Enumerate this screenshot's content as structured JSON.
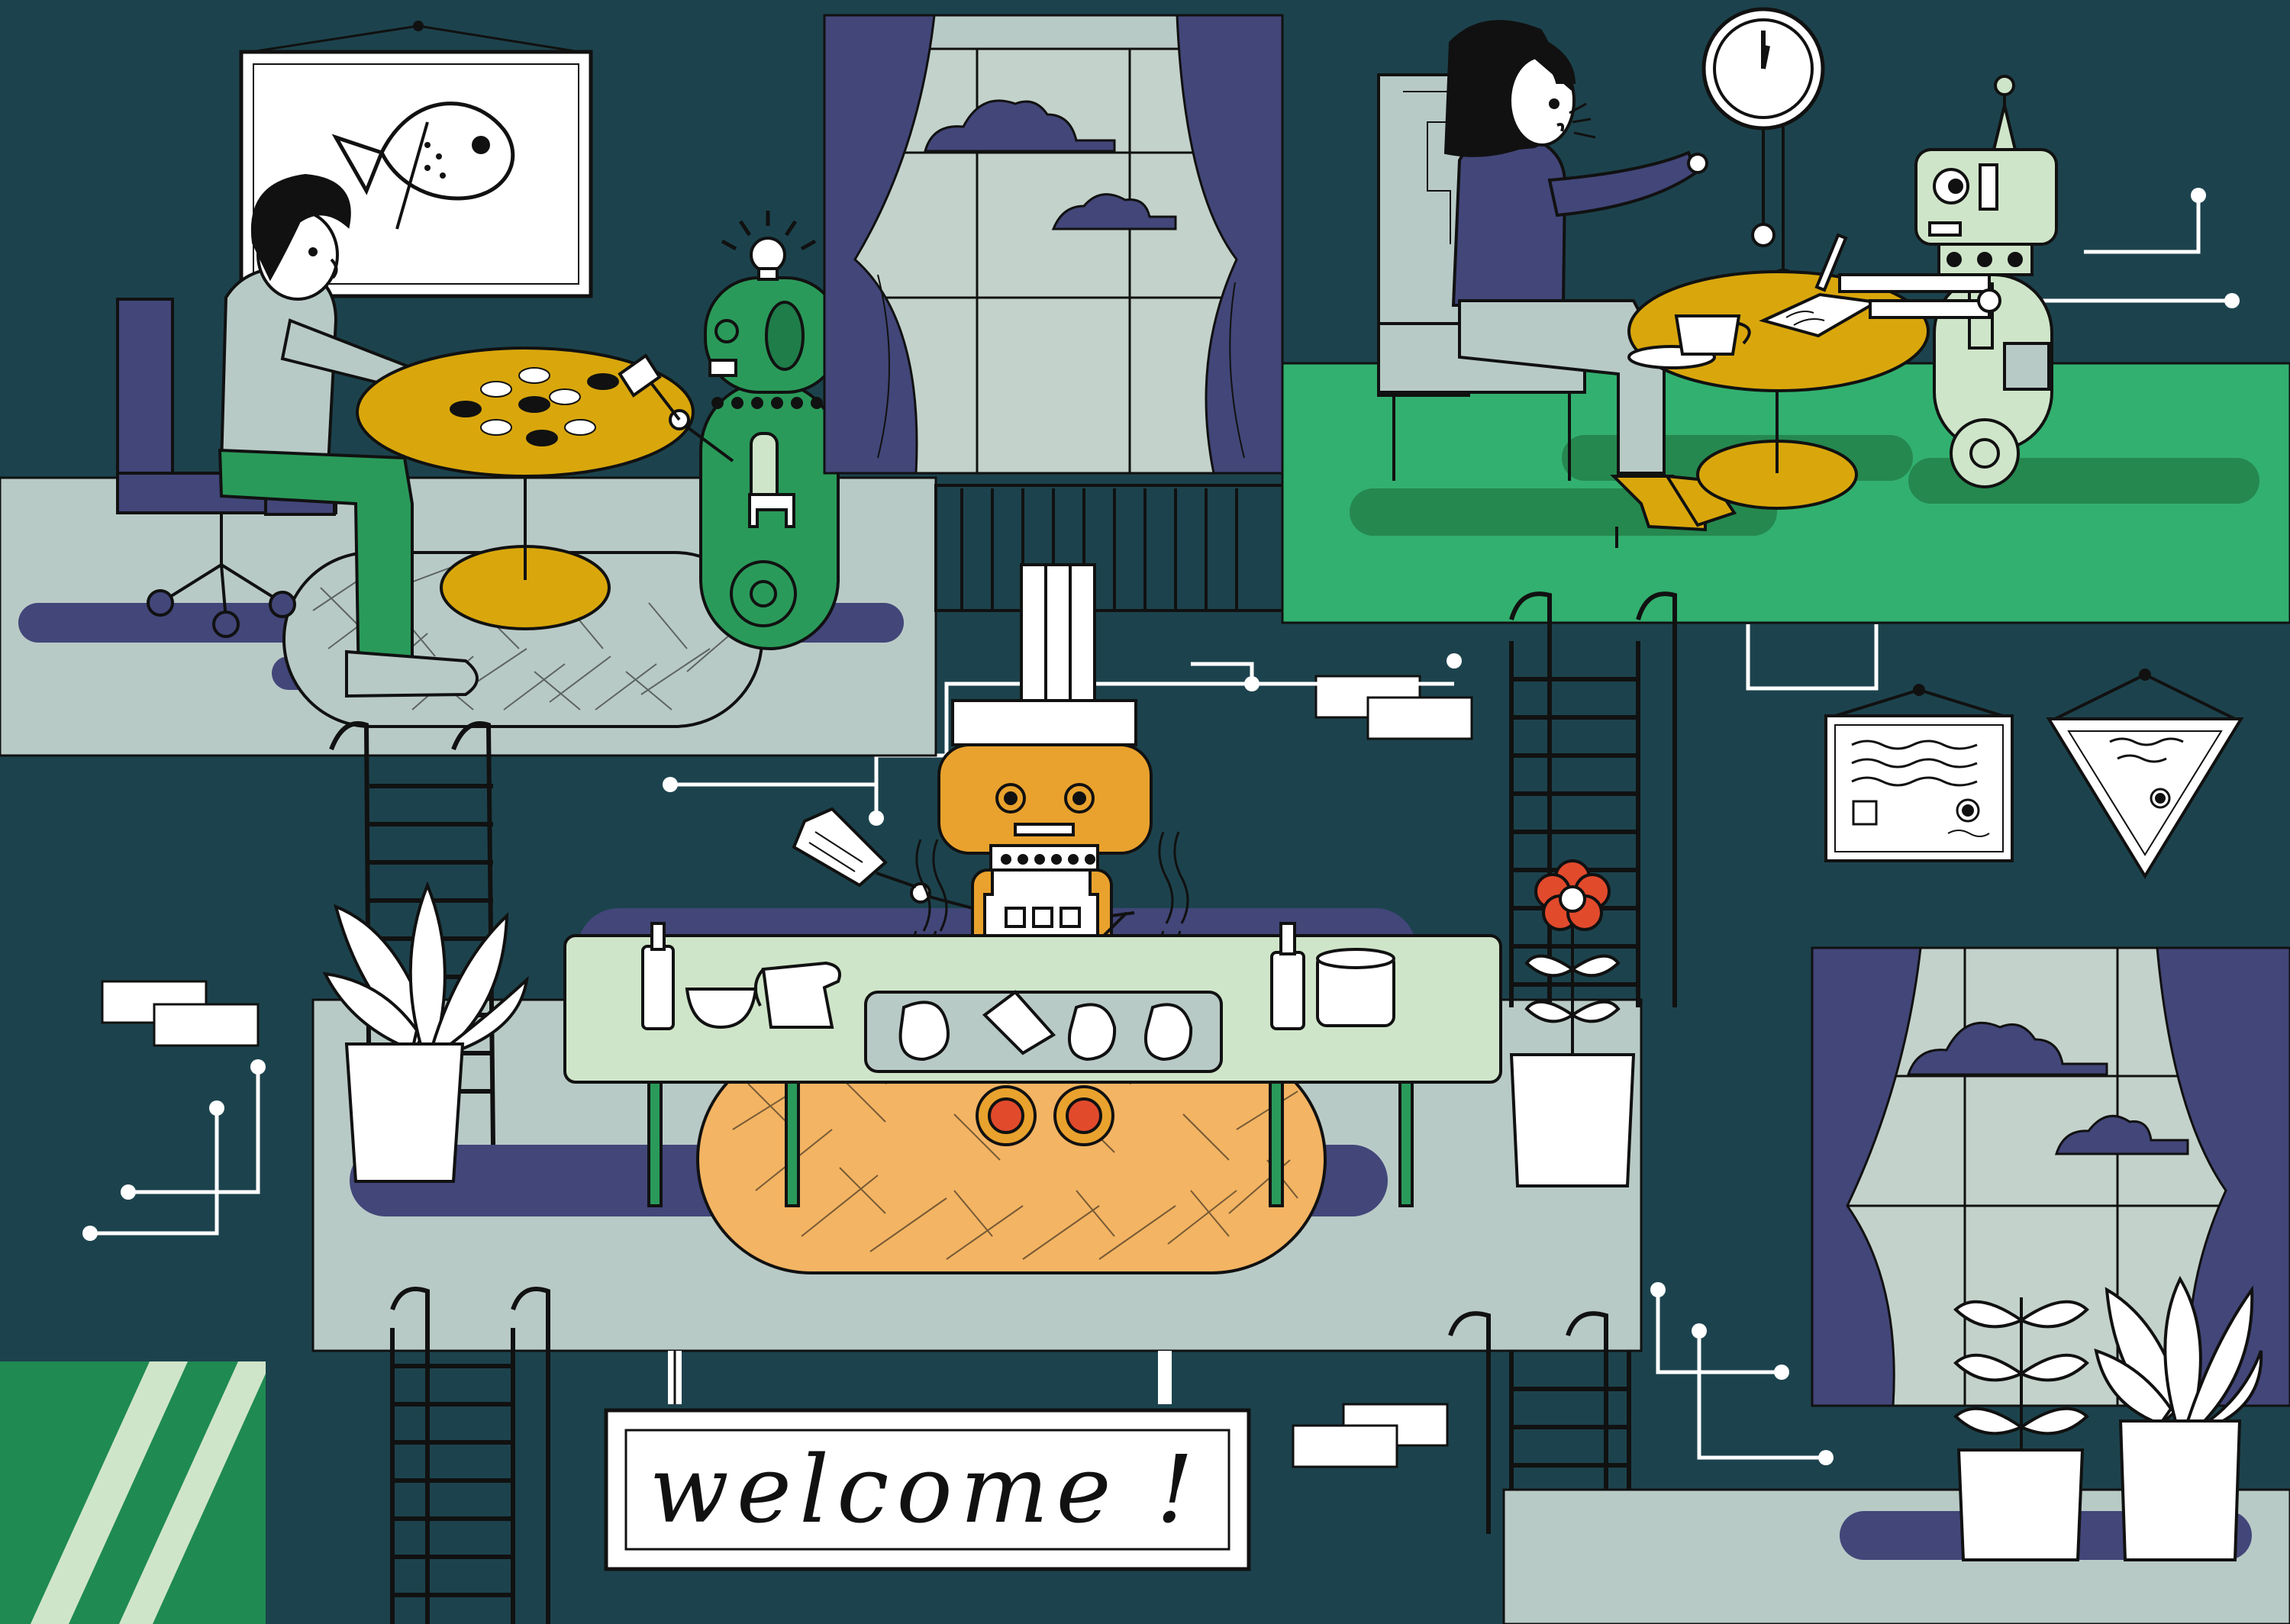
{
  "scene": {
    "sign": {
      "text": "welcome !"
    },
    "palette": {
      "background": "#1c434d",
      "floor": "#b8cac6",
      "green_room": "#32b06f",
      "navy": "#424679",
      "mustard": "#d9a70c",
      "orange": "#e9a22d",
      "robot_green": "#2a9a5a",
      "mint": "#cfe5c9",
      "line": "#111111",
      "white": "#ffffff"
    },
    "elements": [
      "fish-painting",
      "man-at-table",
      "green-robot",
      "game-table",
      "window-center",
      "woman-at-table",
      "wall-clock",
      "mint-robot",
      "chef-robot",
      "kitchen-counter",
      "ladders",
      "potted-plants",
      "flower-pot",
      "diploma-frame",
      "triangle-pennant",
      "window-right",
      "welcome-sign",
      "circuit-lines",
      "wall-bricks"
    ]
  }
}
